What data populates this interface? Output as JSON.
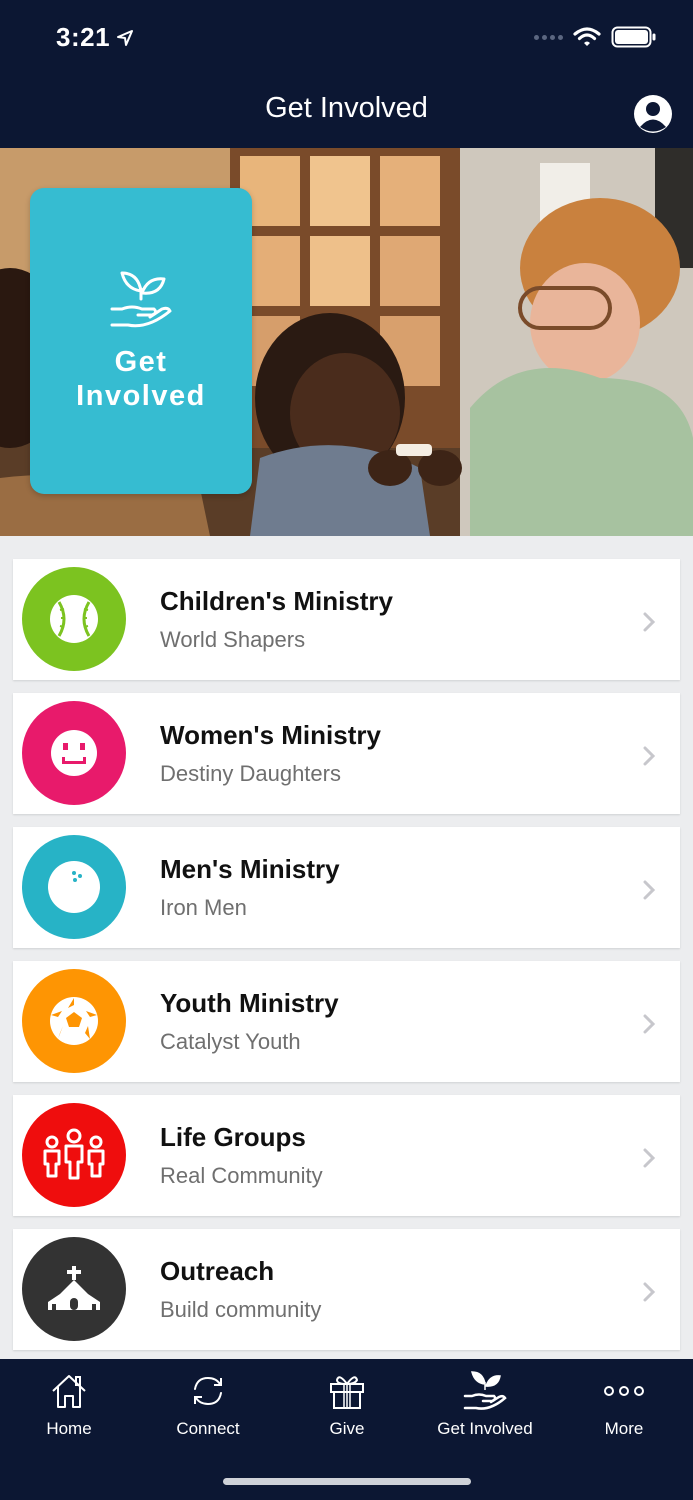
{
  "status_bar": {
    "time": "3:21"
  },
  "header": {
    "title": "Get Involved"
  },
  "hero": {
    "card_title": "Get Involved",
    "card_color": "#36bcd1"
  },
  "items": [
    {
      "title": "Children's Ministry",
      "subtitle": "World Shapers",
      "icon": "baseball-icon",
      "color": "#7cc320"
    },
    {
      "title": "Women's Ministry",
      "subtitle": "Destiny Daughters",
      "icon": "smiley-icon",
      "color": "#e81a6b"
    },
    {
      "title": "Men's Ministry",
      "subtitle": "Iron Men",
      "icon": "bowling-ball-icon",
      "color": "#27b3c6"
    },
    {
      "title": "Youth Ministry",
      "subtitle": "Catalyst Youth",
      "icon": "soccer-ball-icon",
      "color": "#fe9503"
    },
    {
      "title": "Life Groups",
      "subtitle": "Real Community",
      "icon": "people-group-icon",
      "color": "#ef0d0d"
    },
    {
      "title": "Outreach",
      "subtitle": "Build community",
      "icon": "church-icon",
      "color": "#333333"
    }
  ],
  "tabbar": {
    "tabs": [
      {
        "label": "Home",
        "icon": "home-icon"
      },
      {
        "label": "Connect",
        "icon": "sync-icon"
      },
      {
        "label": "Give",
        "icon": "gift-icon"
      },
      {
        "label": "Get Involved",
        "icon": "hand-plant-icon"
      },
      {
        "label": "More",
        "icon": "more-dots-icon"
      }
    ]
  },
  "colors": {
    "header_bg": "#0c1733",
    "list_bg": "#ecedef"
  }
}
